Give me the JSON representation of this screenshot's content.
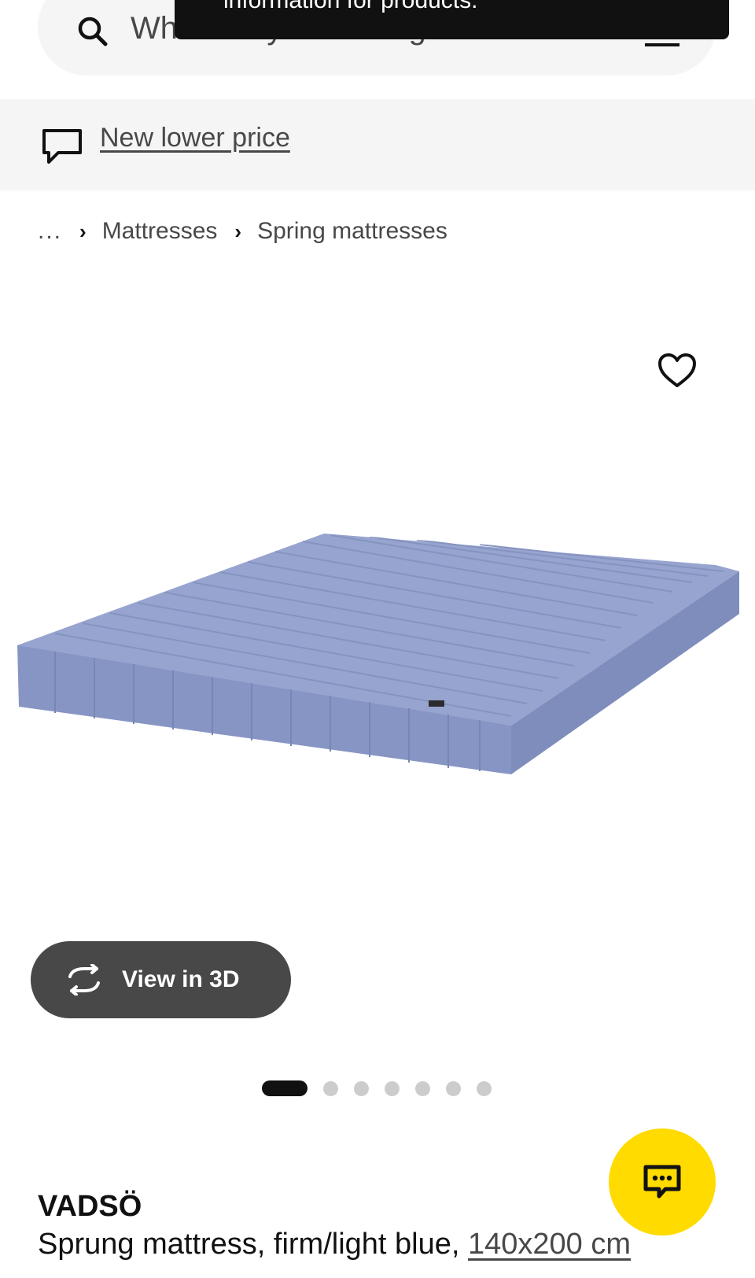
{
  "search": {
    "placeholder": "What are you looking for?"
  },
  "toast": {
    "message": "information for products."
  },
  "promo": {
    "label": "New lower price"
  },
  "breadcrumb": {
    "ellipsis": "...",
    "items": [
      "Mattresses",
      "Spring mattresses"
    ]
  },
  "gallery": {
    "view_3d_label": "View in 3D",
    "image_count": 7,
    "active_index": 0
  },
  "product": {
    "name": "VADSÖ",
    "description": "Sprung mattress, firm/light blue,",
    "size": "140x200 cm"
  },
  "icons": {
    "search": "search-icon",
    "scan": "barcode-scan-icon",
    "promo": "speech-bubble-icon",
    "favorite": "heart-icon",
    "view_3d": "rotate-3d-icon",
    "chat": "chat-icon"
  },
  "colors": {
    "accent_yellow": "#ffdb00",
    "dark_button": "#484848",
    "banner_gray": "#f5f5f5",
    "mattress_blue": "#8e9cc9"
  }
}
